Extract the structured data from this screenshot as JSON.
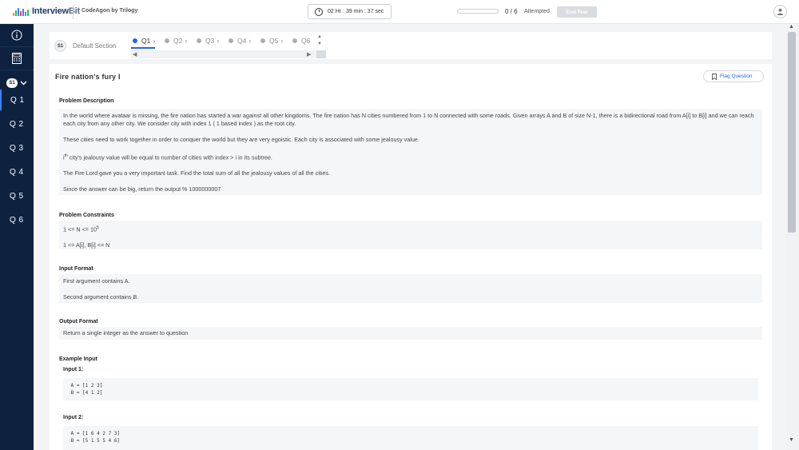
{
  "header": {
    "logo_interview": "Interview",
    "logo_bit": "Bit",
    "org": "CodeAgon by Trilogy",
    "timer": "02 Hr : 39 min : 37 sec",
    "attempted_count": "0 / 6",
    "attempted_label": "Attempted",
    "attempted_fraction": 0,
    "end_test": "End Test"
  },
  "sidebar": {
    "section_pill": "S1",
    "questions": [
      "Q 1",
      "Q 2",
      "Q 3",
      "Q 4",
      "Q 5",
      "Q 6"
    ],
    "active_index": 0
  },
  "section": {
    "badge": "S1",
    "name": "Default Section",
    "tabs": [
      "Q1",
      "Q2",
      "Q3",
      "Q4",
      "Q5",
      "Q6"
    ]
  },
  "question": {
    "title": "Fire nation's fury I",
    "flag_label": "Flag Question",
    "description_heading": "Problem Description",
    "description": [
      "In the world where avataar is missing, the fire nation has started a war against all other kingdoms. The fire nation has N cities numbered from 1 to N connected with some roads. Given arrays A and B of size N-1, there is a bidirectional road from A[i] to B[i] and we can reach each city from any other city. We consider city with index 1 ( 1 based index ) as the root city.",
      "These cities need to work together in order to conquer the world but they are very egoistic. Each city is associated with some jealousy value.",
      "The Fire Lord gave you a very important task. Find the total sum of all the jealousy values of all the cities.",
      "Since the answer can be big, return the output % 1000000007"
    ],
    "ith_prefix": "i",
    "ith_sup": "th",
    "ith_rest": " city's jealousy value will be equal to number of cities with index > i in its subtree.",
    "constraints_heading": "Problem Constraints",
    "constraint1_prefix": "1 <= N <= 10",
    "constraint1_exp": "5",
    "constraint2": "1 <= A[i], B[i] <= N",
    "input_heading": "Input Format",
    "input_lines": [
      "First argument contains A.",
      "Second argument contains B."
    ],
    "output_heading": "Output Format",
    "output_line": "Return a single integer as the answer to question",
    "example_heading": "Example Input",
    "input1_label": "Input 1:",
    "input1_code": " A = [1 2 3]\n B = [4 1 2]",
    "input2_label": "Input 2:",
    "input2_code": " A = [1 6 4 2 7 3]\n B = [5 1 5 5 4 6]"
  }
}
